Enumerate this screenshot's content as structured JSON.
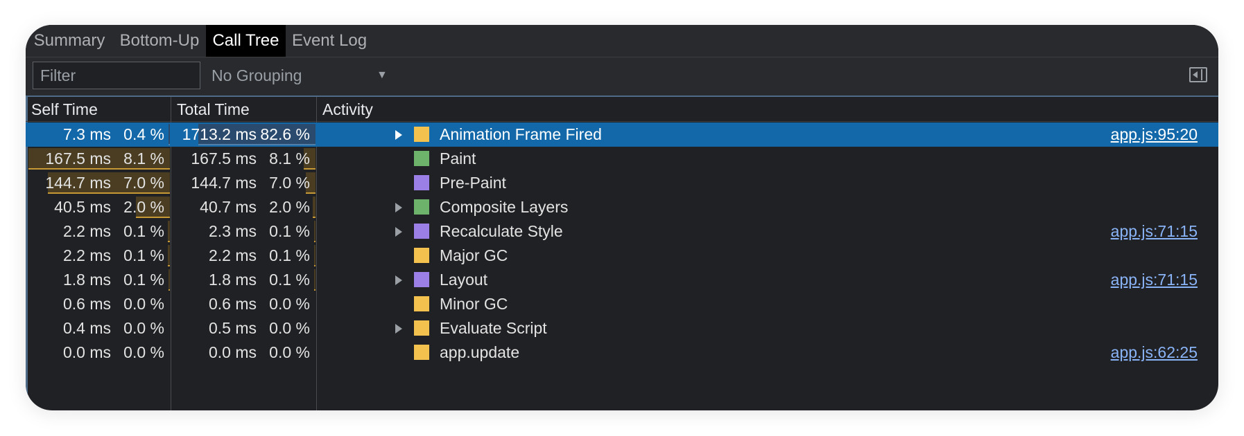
{
  "tabs": [
    {
      "label": "Summary",
      "active": false
    },
    {
      "label": "Bottom-Up",
      "active": false
    },
    {
      "label": "Call Tree",
      "active": true
    },
    {
      "label": "Event Log",
      "active": false
    }
  ],
  "toolbar": {
    "filter_placeholder": "Filter",
    "grouping": "No Grouping",
    "sidebar_toggle_icon": "sidebar-toggle-icon"
  },
  "columns": {
    "self_time": "Self Time",
    "total_time": "Total Time",
    "activity": "Activity"
  },
  "colors": {
    "scripting": "#f2c14e",
    "painting": "#6db36c",
    "rendering": "#9b7fe6",
    "selected": "#1268a8",
    "link": "#8ab4f8"
  },
  "rows": [
    {
      "self_ms": "7.3 ms",
      "self_pct": "0.4 %",
      "total_ms": "1713.2 ms",
      "total_pct": "82.6 %",
      "self_heat": 0.004,
      "total_heat": 0.826,
      "expandable": true,
      "category": "scripting",
      "name": "Animation Frame Fired",
      "link": "app.js:95:20",
      "selected": true
    },
    {
      "self_ms": "167.5 ms",
      "self_pct": "8.1 %",
      "total_ms": "167.5 ms",
      "total_pct": "8.1 %",
      "self_heat": 1.0,
      "total_heat": 0.081,
      "expandable": false,
      "category": "painting",
      "name": "Paint",
      "link": "",
      "selected": false
    },
    {
      "self_ms": "144.7 ms",
      "self_pct": "7.0 %",
      "total_ms": "144.7 ms",
      "total_pct": "7.0 %",
      "self_heat": 0.864,
      "total_heat": 0.07,
      "expandable": false,
      "category": "rendering",
      "name": "Pre-Paint",
      "link": "",
      "selected": false
    },
    {
      "self_ms": "40.5 ms",
      "self_pct": "2.0 %",
      "total_ms": "40.7 ms",
      "total_pct": "2.0 %",
      "self_heat": 0.242,
      "total_heat": 0.02,
      "expandable": true,
      "category": "painting",
      "name": "Composite Layers",
      "link": "",
      "selected": false
    },
    {
      "self_ms": "2.2 ms",
      "self_pct": "0.1 %",
      "total_ms": "2.3 ms",
      "total_pct": "0.1 %",
      "self_heat": 0.013,
      "total_heat": 0.001,
      "expandable": true,
      "category": "rendering",
      "name": "Recalculate Style",
      "link": "app.js:71:15",
      "selected": false
    },
    {
      "self_ms": "2.2 ms",
      "self_pct": "0.1 %",
      "total_ms": "2.2 ms",
      "total_pct": "0.1 %",
      "self_heat": 0.013,
      "total_heat": 0.001,
      "expandable": false,
      "category": "scripting",
      "name": "Major GC",
      "link": "",
      "selected": false
    },
    {
      "self_ms": "1.8 ms",
      "self_pct": "0.1 %",
      "total_ms": "1.8 ms",
      "total_pct": "0.1 %",
      "self_heat": 0.011,
      "total_heat": 0.001,
      "expandable": true,
      "category": "rendering",
      "name": "Layout",
      "link": "app.js:71:15",
      "selected": false
    },
    {
      "self_ms": "0.6 ms",
      "self_pct": "0.0 %",
      "total_ms": "0.6 ms",
      "total_pct": "0.0 %",
      "self_heat": 0.0,
      "total_heat": 0.0,
      "expandable": false,
      "category": "scripting",
      "name": "Minor GC",
      "link": "",
      "selected": false
    },
    {
      "self_ms": "0.4 ms",
      "self_pct": "0.0 %",
      "total_ms": "0.5 ms",
      "total_pct": "0.0 %",
      "self_heat": 0.0,
      "total_heat": 0.0,
      "expandable": true,
      "category": "scripting",
      "name": "Evaluate Script",
      "link": "",
      "selected": false
    },
    {
      "self_ms": "0.0 ms",
      "self_pct": "0.0 %",
      "total_ms": "0.0 ms",
      "total_pct": "0.0 %",
      "self_heat": 0.0,
      "total_heat": 0.0,
      "expandable": false,
      "category": "scripting",
      "name": "app.update",
      "link": "app.js:62:25",
      "selected": false
    }
  ]
}
